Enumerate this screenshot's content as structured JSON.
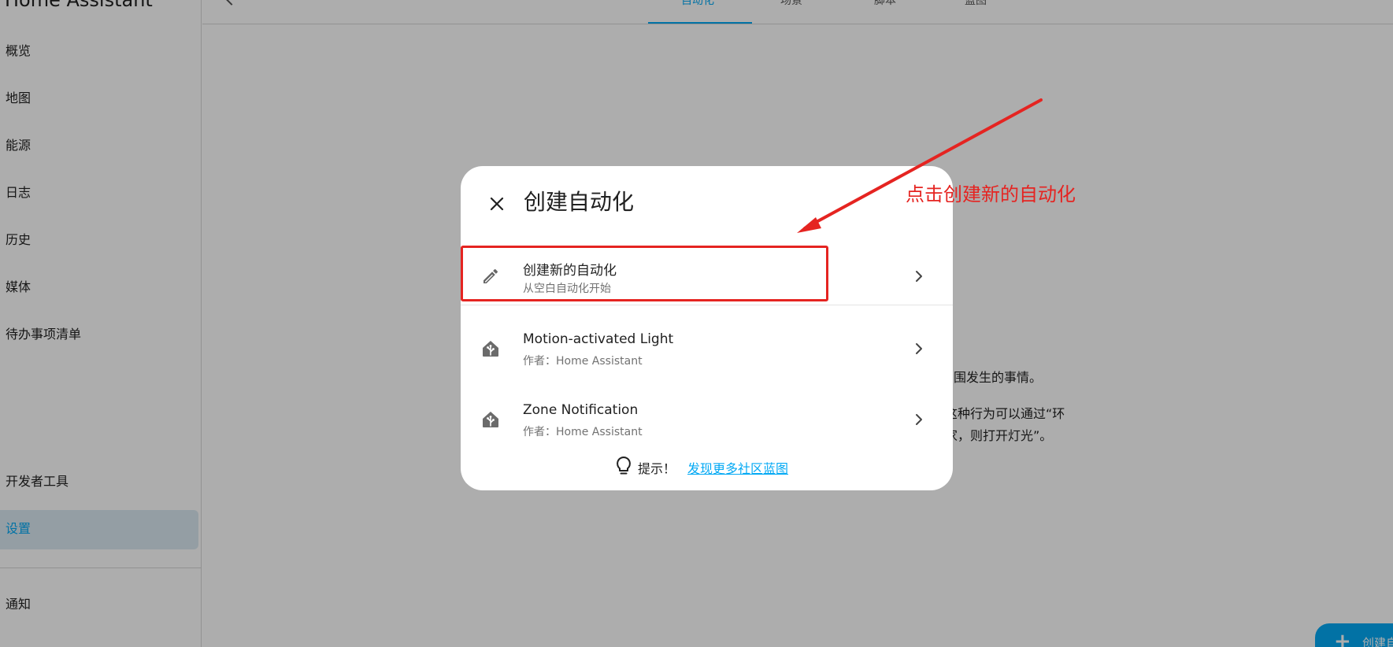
{
  "app_title": "Home Assistant",
  "sidebar": {
    "items": [
      {
        "label": "概览"
      },
      {
        "label": "地图"
      },
      {
        "label": "能源"
      },
      {
        "label": "日志"
      },
      {
        "label": "历史"
      },
      {
        "label": "媒体"
      },
      {
        "label": "待办事项清单"
      }
    ],
    "bottom_items": [
      {
        "label": "开发者工具"
      },
      {
        "label": "设置",
        "active": true
      }
    ],
    "footer_items": [
      {
        "label": "通知"
      }
    ]
  },
  "topbar": {
    "tabs": [
      {
        "label": "自动化",
        "active": true
      },
      {
        "label": "场景"
      },
      {
        "label": "脚本"
      },
      {
        "label": "蓝图"
      }
    ]
  },
  "background_text": {
    "line1": "围发生的事情。",
    "line2": "这种行为可以通过“环",
    "line3": "家，则打开灯光”。"
  },
  "fab": {
    "label": "创建自"
  },
  "dialog": {
    "title": "创建自动化",
    "options": [
      {
        "title": "创建新的自动化",
        "subtitle": "从空白自动化开始",
        "icon": "pencil-icon"
      },
      {
        "title": "Motion-activated Light",
        "subtitle": "作者：Home Assistant",
        "icon": "home-assistant-blueprint-icon"
      },
      {
        "title": "Zone Notification",
        "subtitle": "作者：Home Assistant",
        "icon": "home-assistant-blueprint-icon"
      }
    ],
    "tip": {
      "label": "提示！",
      "link": "发现更多社区蓝图"
    }
  },
  "annotation": {
    "text": "点击创建新的自动化",
    "color": "#e52421"
  },
  "colors": {
    "accent": "#03a9f4",
    "annotation": "#e52421",
    "active_nav_bg": "#dbe9f2"
  }
}
